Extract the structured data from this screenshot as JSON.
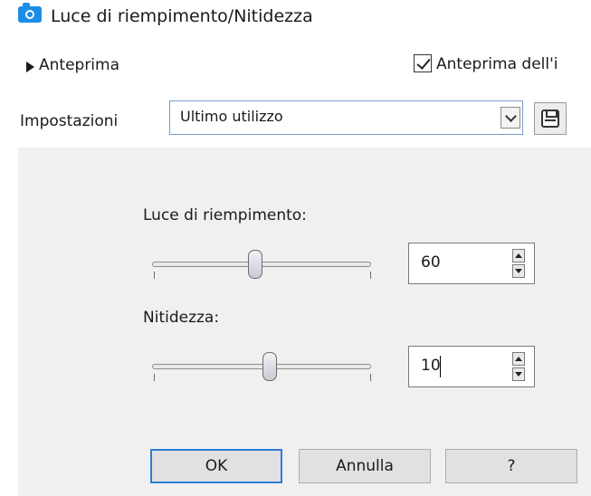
{
  "window": {
    "title": "Luce di riempimento/Nitidezza",
    "title_icon": "camera-icon"
  },
  "preview": {
    "toggle_label": "Anteprima",
    "image_preview_label": "Anteprima dell'i",
    "image_preview_checked": true
  },
  "settings": {
    "label": "Impostazioni",
    "selected": "Ultimo utilizzo",
    "save_icon": "save-icon"
  },
  "fill_light": {
    "label": "Luce di riempimento:",
    "value": "60"
  },
  "sharpness": {
    "label": "Nitidezza:",
    "value": "10"
  },
  "buttons": {
    "ok": "OK",
    "cancel": "Annulla",
    "help": "?"
  },
  "colors": {
    "accent": "#1a8ee6",
    "default_button_border": "#2e7cd6",
    "panel_bg": "#f0f0f0"
  }
}
